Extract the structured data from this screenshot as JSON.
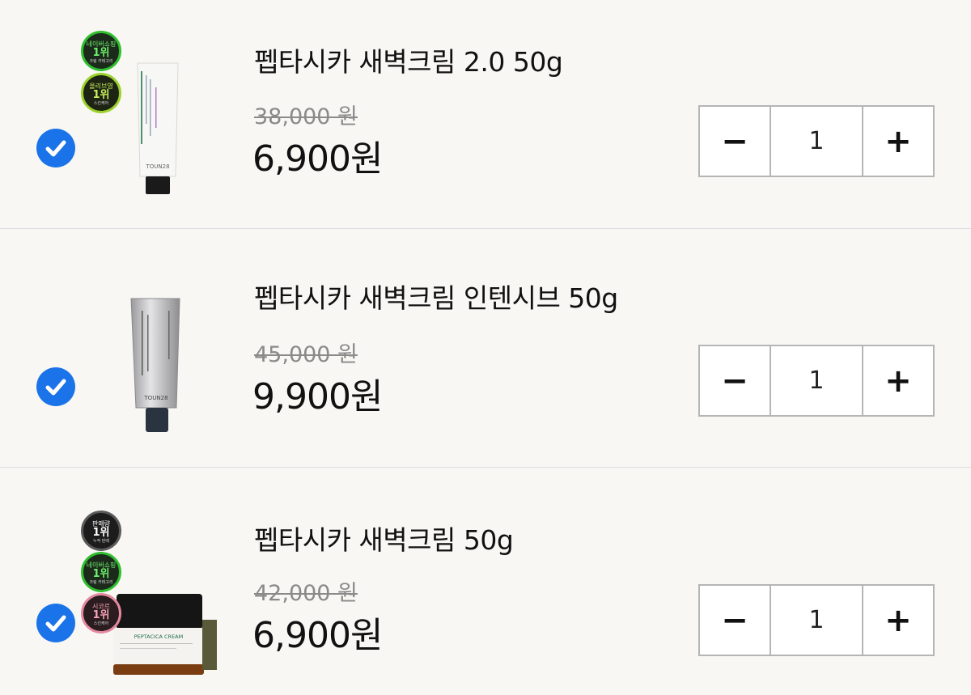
{
  "colors": {
    "background": "#f8f7f3",
    "check": "#1a73e8",
    "divider": "#dcdbe0"
  },
  "items": [
    {
      "name": "펩타시카 새벽크림 2.0 50g",
      "original_price": "38,000 원",
      "price": "6,900원",
      "quantity": "1",
      "checked": true,
      "product_brand": "TOUN28",
      "badges": [
        {
          "top": "네이버쇼핑",
          "rank": "1위",
          "sub": "크림 카테고리"
        },
        {
          "top": "올리브영",
          "rank": "1위",
          "sub": "스킨케어"
        }
      ]
    },
    {
      "name": "펩타시카 새벽크림 인텐시브 50g",
      "original_price": "45,000 원",
      "price": "9,900원",
      "quantity": "1",
      "checked": true,
      "product_brand": "TOUN28",
      "badges": []
    },
    {
      "name": "펩타시카 새벽크림 50g",
      "original_price": "42,000 원",
      "price": "6,900원",
      "quantity": "1",
      "checked": true,
      "product_label": "PEPTACICA CREAM",
      "badges": [
        {
          "top": "판매량",
          "rank": "1위",
          "sub": "누적 판매"
        },
        {
          "top": "네이버쇼핑",
          "rank": "1위",
          "sub": "크림 카테고리"
        },
        {
          "top": "시코르",
          "rank": "1위",
          "sub": "스킨케어"
        }
      ]
    }
  ],
  "controls": {
    "minus": "−",
    "plus": "+"
  },
  "icons": {
    "check": "check-circle-icon"
  }
}
